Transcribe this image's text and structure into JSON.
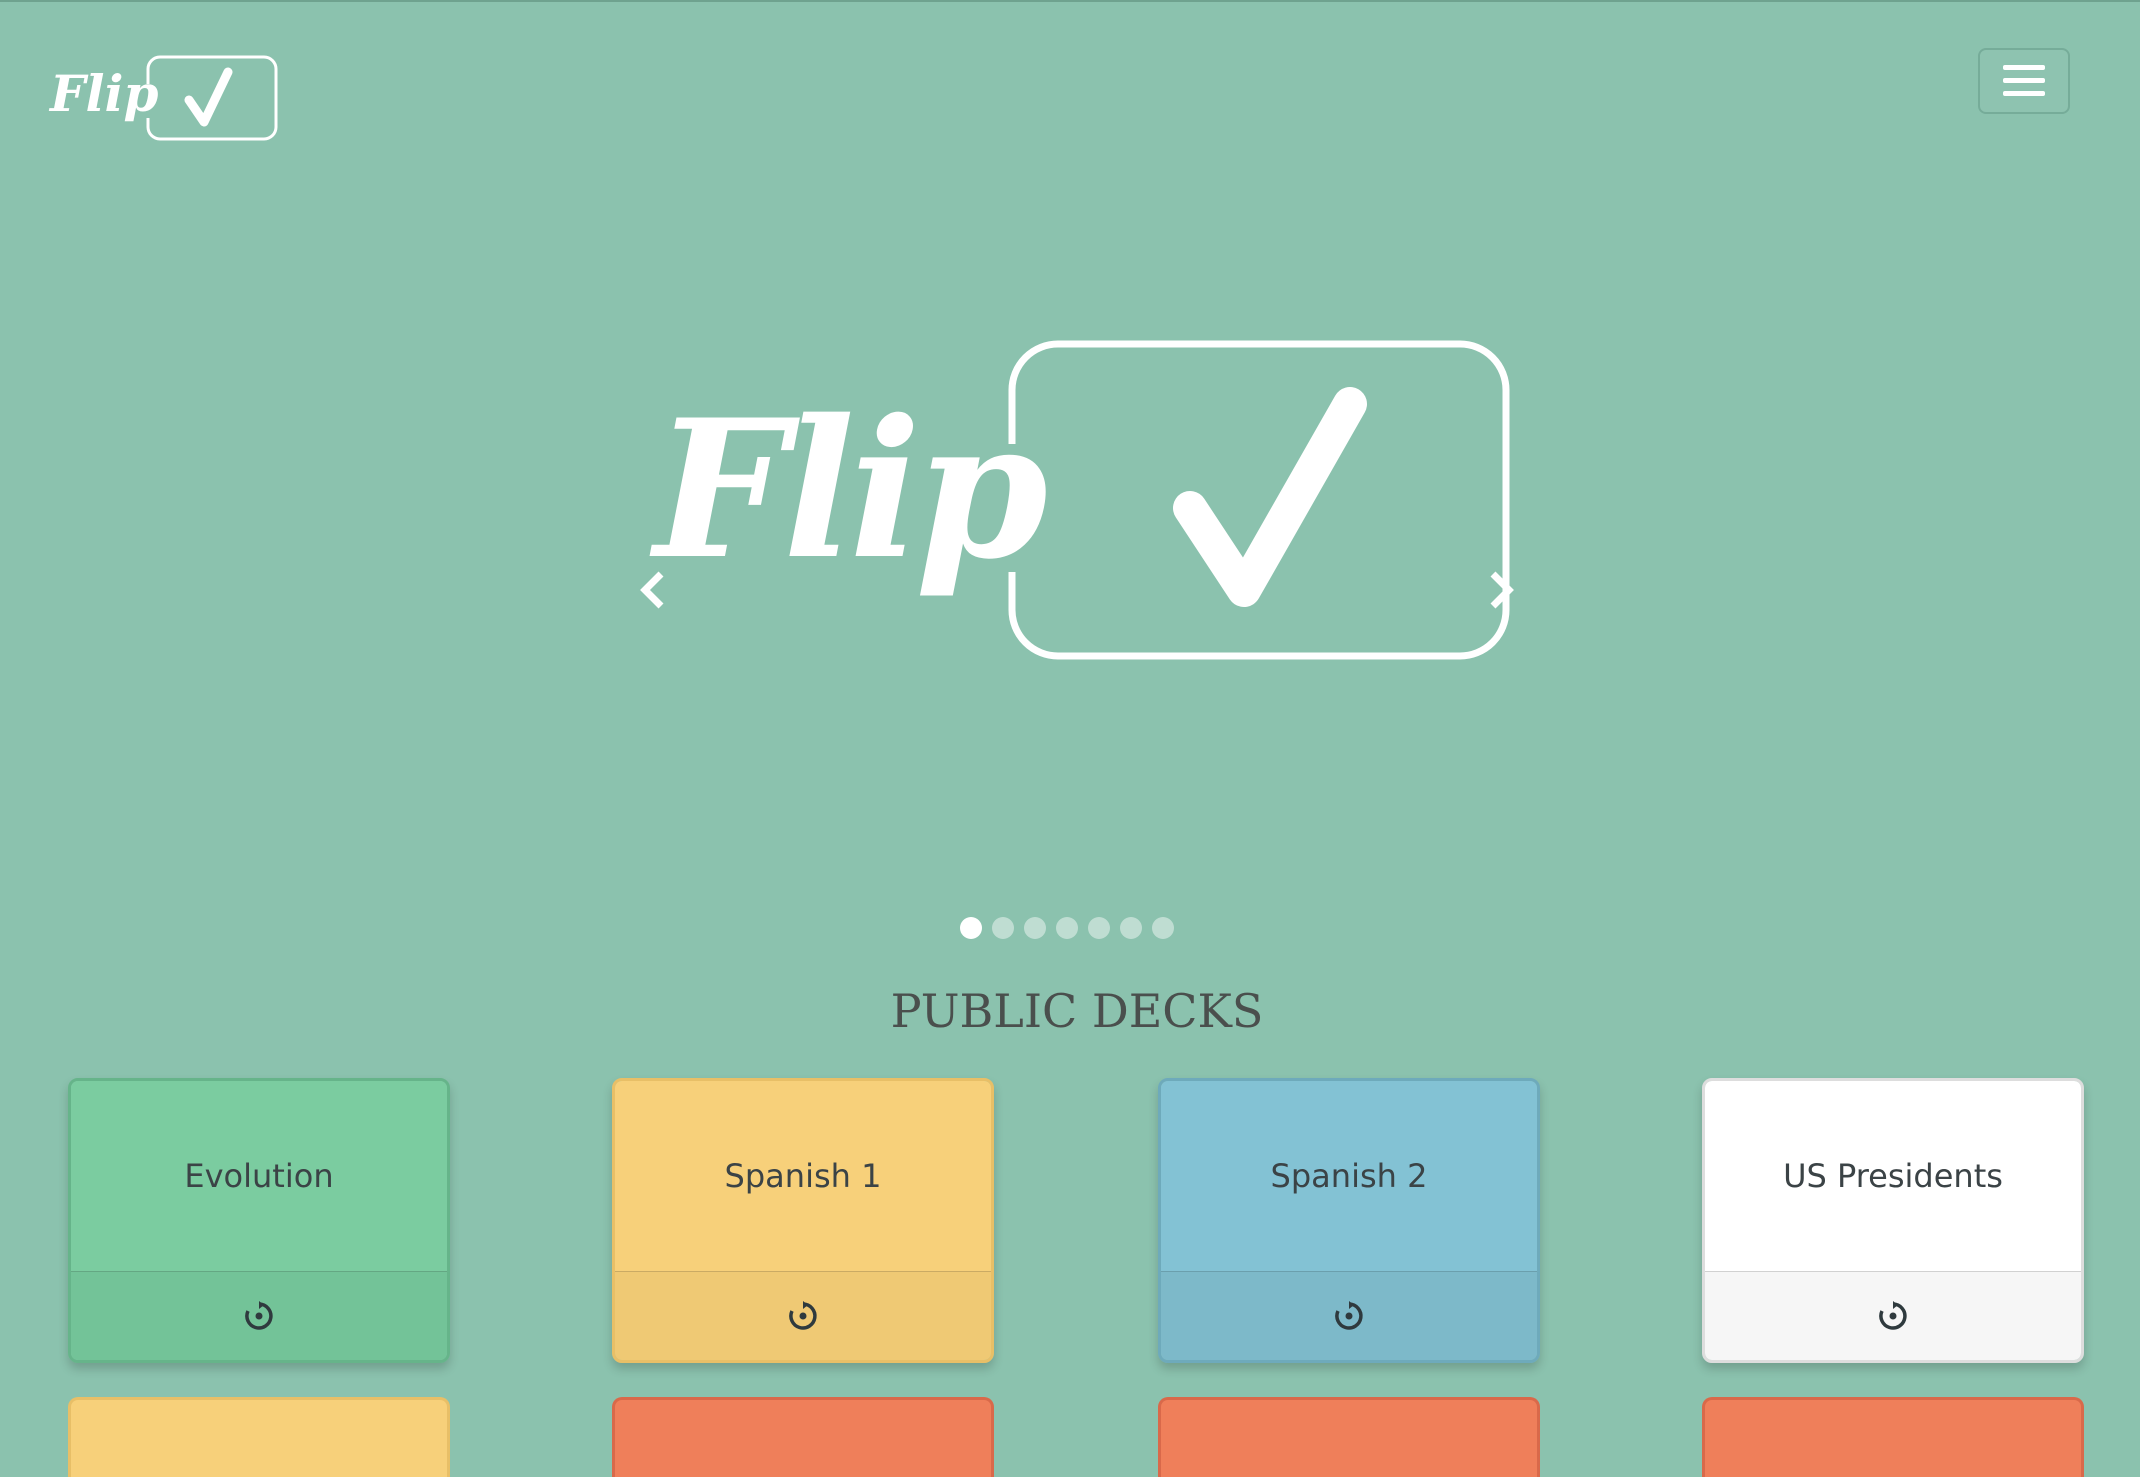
{
  "brand": {
    "logo_text": "Flip",
    "logo_mark": "✓"
  },
  "navbar": {
    "menu_icon": "hamburger-icon"
  },
  "carousel": {
    "logo_text": "Flip",
    "logo_mark": "✓",
    "slide_count": 7,
    "active_index": 0,
    "prev_icon": "chevron-left-icon",
    "next_icon": "chevron-right-icon"
  },
  "section": {
    "title": "PUBLIC DECKS"
  },
  "decks": [
    {
      "title": "Evolution",
      "color": "#7bcca0",
      "footer_color": "#73c398",
      "border": "#66b48a",
      "icon": "flip-icon"
    },
    {
      "title": "Spanish 1",
      "color": "#f7d07a",
      "footer_color": "#efc974",
      "border": "#e8bf67",
      "icon": "flip-icon"
    },
    {
      "title": "Spanish 2",
      "color": "#83c2d4",
      "footer_color": "#7db9c9",
      "border": "#6eaabb",
      "icon": "flip-icon"
    },
    {
      "title": "US Presidents",
      "color": "#ffffff",
      "footer_color": "#f6f6f6",
      "border": "#dddddd",
      "icon": "flip-icon"
    }
  ],
  "decks_row2_colors": [
    "#f7d07a",
    "#ef7f5a",
    "#ef7f5a",
    "#ef7f5a"
  ],
  "colors": {
    "background": "#8bc2ae",
    "logo": "#ffffff",
    "heading": "#4a4f4d"
  }
}
